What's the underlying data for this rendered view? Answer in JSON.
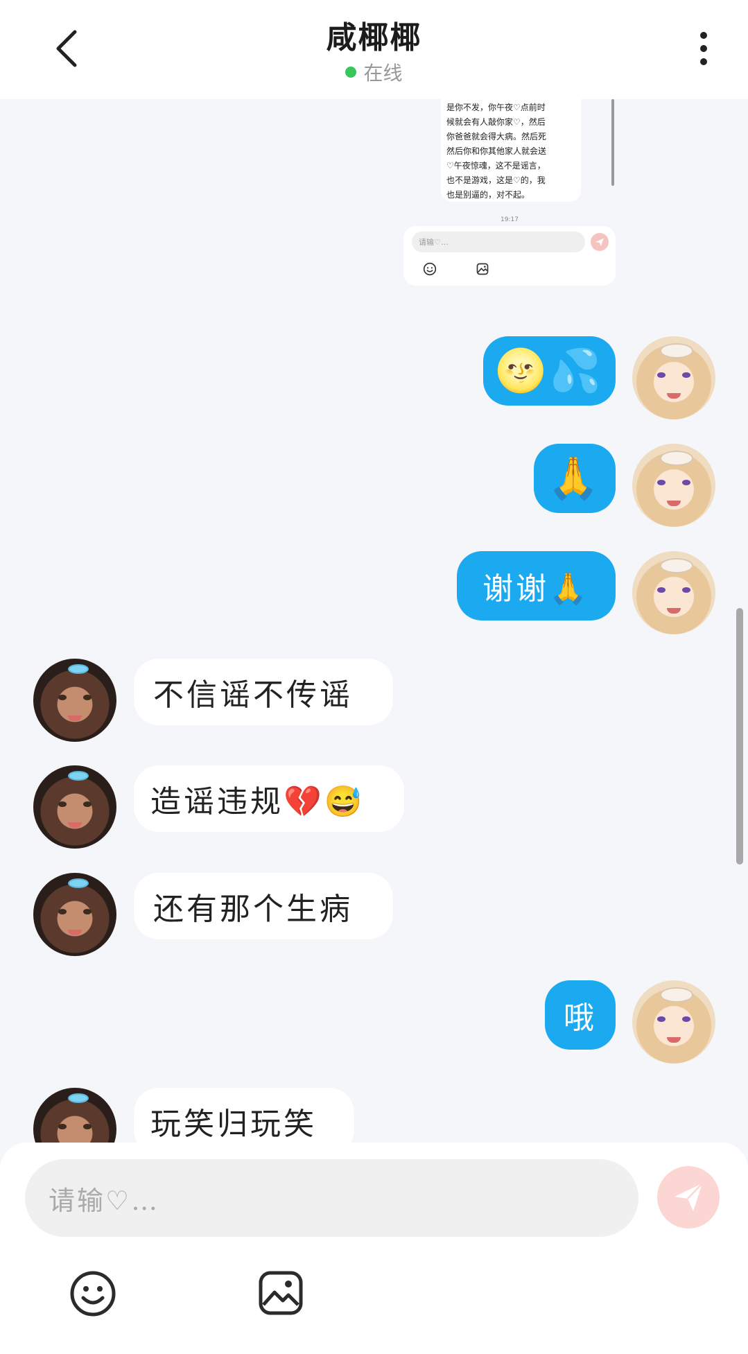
{
  "header": {
    "title": "咸椰椰",
    "status": "在线",
    "status_color": "#35c759"
  },
  "nested_screenshot": {
    "text_lines": [
      "是你不发，你午夜♡点前时",
      "候就会有人敲你家♡，然后",
      "你爸爸就会得大病。然后死",
      "然后你和你其他家人就会送",
      "♡午夜惊魂，这不是谣言，",
      "也不是游戏，这是♡的，我",
      "也是别逼的，对不起。"
    ],
    "time": "19:17",
    "input_placeholder": "请输♡…"
  },
  "messages": [
    {
      "from": "me",
      "text": "🌝💦"
    },
    {
      "from": "me",
      "text": "🙏"
    },
    {
      "from": "me",
      "text": "谢谢🙏"
    },
    {
      "from": "other",
      "text": "不信谣不传谣"
    },
    {
      "from": "other",
      "text": "造谣违规💔😅"
    },
    {
      "from": "other",
      "text": "还有那个生病"
    },
    {
      "from": "me",
      "text": "哦"
    },
    {
      "from": "other",
      "text": "玩笑归玩笑"
    }
  ],
  "composer": {
    "placeholder": "请输♡…"
  },
  "icons": {
    "back": "back-arrow-icon",
    "more": "more-vertical-icon",
    "send": "paper-plane-icon",
    "emoji": "smiley-icon",
    "image": "image-icon"
  },
  "colors": {
    "my_bubble": "#1ba9f0",
    "other_bubble": "#ffffff",
    "send_button": "#fbd6d3"
  }
}
